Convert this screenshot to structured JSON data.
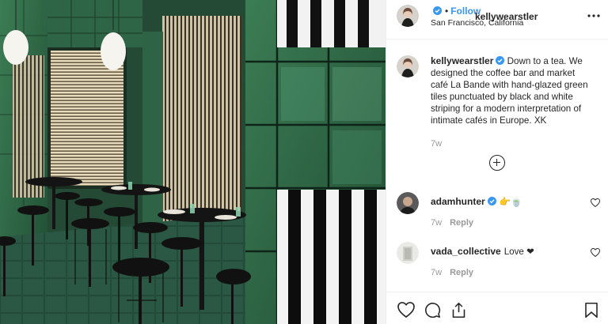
{
  "post": {
    "username": "kellywearstler",
    "follow_label": "Follow",
    "dot": "•",
    "location": "San Francisco, California",
    "more_label": "•••"
  },
  "caption": {
    "username": "kellywearstler",
    "text": "Down to a tea. We designed the coffee bar and market café La Bande with hand-glazed green tiles punctuated by black and white striping for a modern interpretation of intimate cafés in Europe. XK",
    "time": "7w"
  },
  "comments": [
    {
      "username": "adamhunter",
      "text": "👉🍵",
      "time": "7w",
      "reply_label": "Reply",
      "verified": true
    },
    {
      "username": "vada_collective",
      "text": "Love ❤",
      "time": "7w",
      "reply_label": "Reply",
      "verified": false
    }
  ],
  "icons": {
    "verified": "verified-badge-icon",
    "load_more": "plus-circle-icon",
    "like": "heart-icon",
    "comment": "comment-bubble-icon",
    "share": "share-icon",
    "save": "bookmark-icon",
    "more": "more-options-icon"
  },
  "colors": {
    "link_blue": "#3897f0",
    "verified_blue": "#3897f0",
    "muted": "#999999",
    "heart_red": "#ed4956",
    "tile_green": "#2f6b45"
  }
}
